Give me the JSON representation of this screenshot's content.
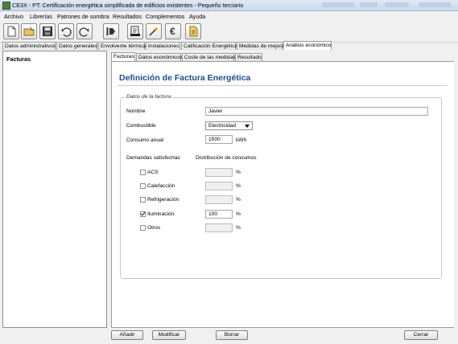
{
  "window": {
    "title": "CE3X - PT: Certificación energética simplificada de edificios existentes - Pequeño terciario"
  },
  "menu": [
    "Archivo",
    "Librerías",
    "Patrones de sombra",
    "Resultados",
    "Complementos",
    "Ayuda"
  ],
  "toolbar": {
    "icons": [
      "new-file-icon",
      "open-folder-icon",
      "save-icon",
      "undo-icon",
      "redo-icon",
      "import-icon",
      "certificate-icon",
      "calculate-icon",
      "euro-icon",
      "report-icon"
    ],
    "euro_symbol": "€"
  },
  "main_tabs": [
    "Datos administrativos",
    "Datos generales",
    "Envolvente térmica",
    "Instalaciones",
    "Calificación Energética",
    "Medidas de mejora",
    "Análisis económico"
  ],
  "main_tab_active": "Análisis económico",
  "left_panel": {
    "items": [
      "Facturas"
    ]
  },
  "sub_tabs": [
    "Facturas",
    "Datos económicos",
    "Coste de las medidas",
    "Resultado"
  ],
  "sub_tab_active": "Facturas",
  "form": {
    "heading": "Definición de Factura Energética",
    "group_label": "Datos de la factura",
    "nombre_label": "Nombre",
    "nombre_value": "Javier",
    "combustible_label": "Combustible",
    "combustible_value": "Electricidad",
    "consumo_label": "Consumo anual",
    "consumo_value": "1500",
    "consumo_unit": "kWh",
    "demandas_label": "Demandas satisfechas",
    "distribucion_label": "Distribución de consumos",
    "demandas": [
      {
        "label": "ACS",
        "checked": false,
        "value": "",
        "unit": "%"
      },
      {
        "label": "Calefacción",
        "checked": false,
        "value": "",
        "unit": "%"
      },
      {
        "label": "Refrigeración",
        "checked": false,
        "value": "",
        "unit": "%"
      },
      {
        "label": "Iluminación",
        "checked": true,
        "value": "100",
        "unit": "%"
      },
      {
        "label": "Otros",
        "checked": false,
        "value": "",
        "unit": "%"
      }
    ]
  },
  "buttons": {
    "add": "Añadir",
    "modify": "Modificar",
    "delete": "Borrar",
    "close": "Cerrar"
  }
}
